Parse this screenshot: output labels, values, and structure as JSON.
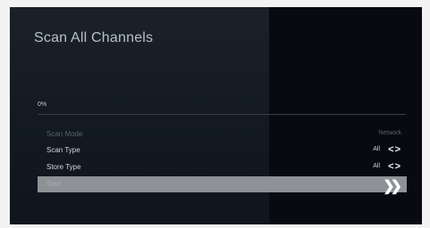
{
  "screen": {
    "title": "Scan All Channels"
  },
  "progress": {
    "label": "0%",
    "percent": 0
  },
  "rows": [
    {
      "label": "Scan Mode",
      "value": "Network"
    },
    {
      "label": "Scan Type",
      "value": "All"
    },
    {
      "label": "Store Type",
      "value": "All"
    },
    {
      "label": "Start",
      "value": ""
    }
  ],
  "icons": {
    "arrows": "left-right-arrows-icon",
    "go": "double-chevron-right-icon"
  }
}
